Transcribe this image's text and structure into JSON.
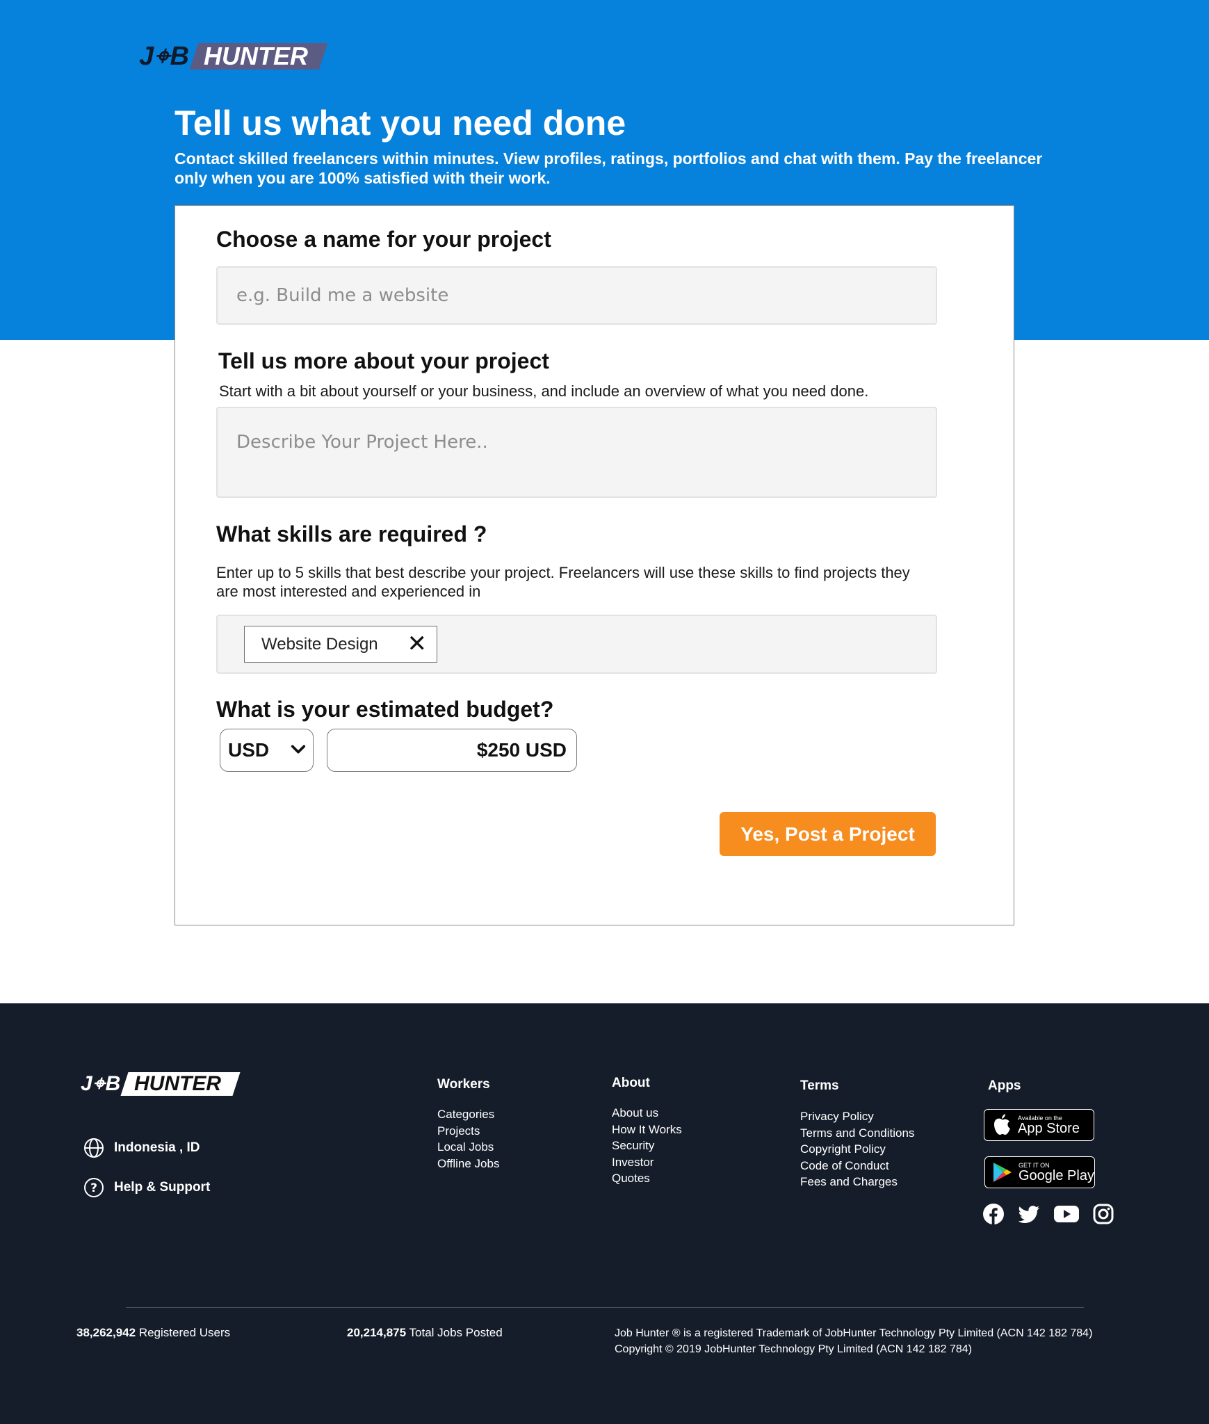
{
  "brand": {
    "logo_job": "J⌖B",
    "logo_hunter": "HUNTER"
  },
  "hero": {
    "title": "Tell us what you need done",
    "subtitle": "Contact skilled freelancers within minutes. View profiles, ratings, portfolios and chat with them. Pay the freelancer only when you are 100% satisfied with their work."
  },
  "form": {
    "name_heading": "Choose a name for your project",
    "name_placeholder": "e.g. Build me a website",
    "desc_heading": "Tell us more about your project",
    "desc_help": "Start with a bit about yourself or your business, and include an overview of what you need done.",
    "desc_placeholder": "Describe Your Project Here..",
    "skills_heading": "What skills are required ?",
    "skills_help": "Enter up to 5 skills that best describe your project. Freelancers will use these skills to find projects they are most interested and experienced in",
    "skills": [
      "Website Design"
    ],
    "budget_heading": "What is your estimated budget?",
    "currency": "USD",
    "budget_value": "$250 USD",
    "submit_label": "Yes, Post a Project"
  },
  "footer": {
    "location": "Indonesia , ID",
    "help": "Help & Support",
    "columns": [
      {
        "title": "Workers",
        "items": [
          "Categories",
          "Projects",
          "Local Jobs",
          "Offline Jobs"
        ]
      },
      {
        "title": "About",
        "items": [
          "About us",
          "How It Works",
          "Security",
          "Investor",
          "Quotes"
        ]
      },
      {
        "title": "Terms",
        "items": [
          "Privacy Policy",
          "Terms and Conditions",
          "Copyright Policy",
          "Code of Conduct",
          "Fees and Charges"
        ]
      }
    ],
    "apps_title": "Apps",
    "appstore_small": "Available on the",
    "appstore_big": "App Store",
    "googleplay_small": "GET IT ON",
    "googleplay_big": "Google Play",
    "social_icons": [
      "facebook-icon",
      "twitter-icon",
      "youtube-icon",
      "instagram-icon"
    ],
    "users_count": "38,262,942",
    "users_label": "Registered Users",
    "jobs_count": "20,214,875",
    "jobs_label": "Total Jobs Posted",
    "legal_line1": "Job Hunter ® is a registered Trademark of JobHunter Technology Pty Limited (ACN 142 182 784)",
    "legal_line2": "Copyright © 2019 JobHunter Technology Pty Limited (ACN 142 182 784)"
  },
  "colors": {
    "hero_bg": "#0681dc",
    "button_orange": "#f78c1f",
    "footer_bg": "#161d2a"
  }
}
